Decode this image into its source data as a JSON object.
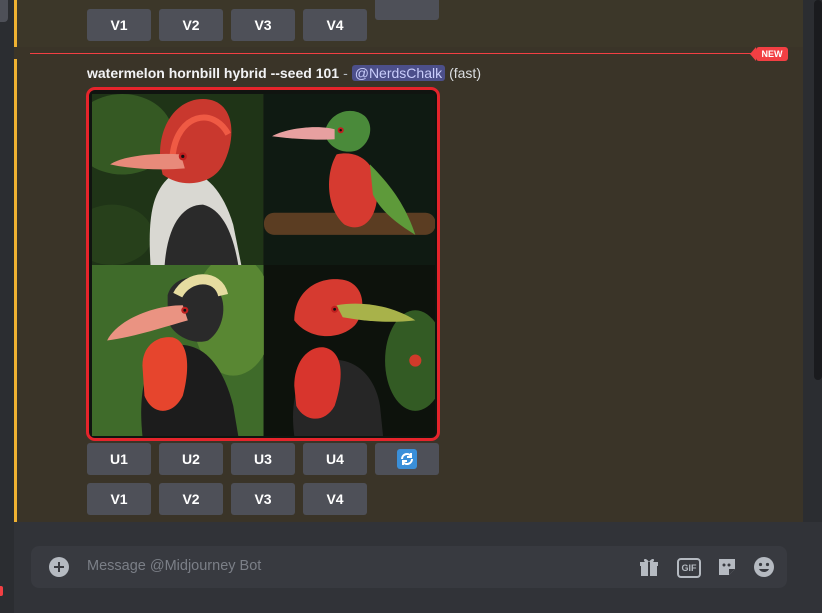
{
  "message": {
    "prompt": "watermelon hornbill hybrid --seed 101",
    "separator": "-",
    "mention": "@NerdsChalk",
    "speed": "(fast)",
    "image_alt": "Grid of four watermelon hornbill hybrid bird images"
  },
  "divider": {
    "badge": "NEW"
  },
  "prev_buttons": {
    "v": [
      "V1",
      "V2",
      "V3",
      "V4"
    ]
  },
  "buttons": {
    "u": [
      "U1",
      "U2",
      "U3",
      "U4"
    ],
    "v": [
      "V1",
      "V2",
      "V3",
      "V4"
    ],
    "refresh_icon": "refresh-arrows-icon"
  },
  "composer": {
    "placeholder": "Message @Midjourney Bot",
    "icons": [
      "add-circle-icon",
      "gift-icon",
      "gif-icon",
      "sticker-icon",
      "emoji-icon"
    ]
  },
  "colors": {
    "highlight_border": "#e5242b",
    "new_divider": "#f23f43",
    "mention_bar": "#f0b232",
    "button_bg": "#4e5058",
    "mention_bg": "#4c4f8a"
  }
}
